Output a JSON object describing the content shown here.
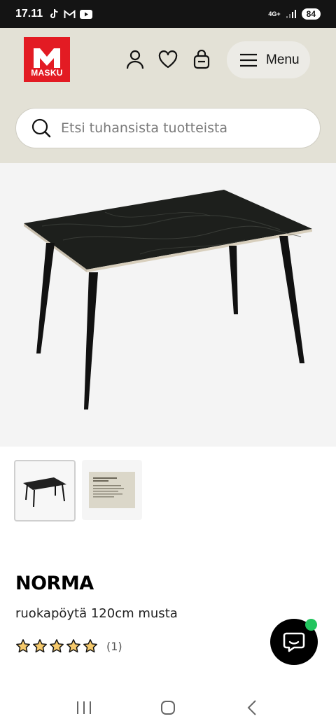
{
  "status_bar": {
    "time": "17.11",
    "network": "4G+",
    "battery": "84"
  },
  "header": {
    "logo_text": "MASKU",
    "menu_label": "Menu",
    "search": {
      "placeholder": "Etsi tuhansista tuotteista",
      "value": ""
    },
    "icons": [
      "user-icon",
      "heart-icon",
      "shopping-bag-icon",
      "hamburger-icon"
    ]
  },
  "product": {
    "brand": "NORMA",
    "subtitle": "ruokapöytä 120cm musta",
    "rating": 5,
    "review_count": "(1)",
    "thumbnails": [
      "product-photo",
      "care-instructions-card"
    ]
  },
  "colors": {
    "brand_red": "#e31b23",
    "header_bg": "#e3e1d6",
    "chat_online": "#22c55e",
    "star": "#f5c96b"
  }
}
